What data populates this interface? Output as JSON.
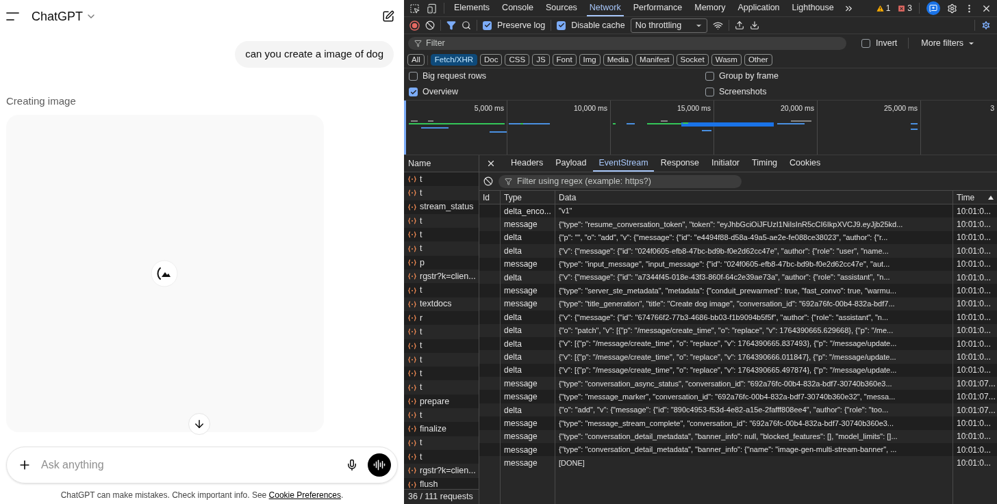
{
  "chat": {
    "title": "ChatGPT",
    "user_message": "can you create a image of dog",
    "status": "Creating image",
    "composer": {
      "placeholder": "Ask anything"
    },
    "disclaimer": "ChatGPT can make mistakes. Check important info. See ",
    "disclaimer_link": "Cookie Preferences",
    "disclaimer_end": "."
  },
  "devtools": {
    "tabs": [
      {
        "label": "Elements",
        "selected": false
      },
      {
        "label": "Console",
        "selected": false
      },
      {
        "label": "Sources",
        "selected": false
      },
      {
        "label": "Network",
        "selected": true
      },
      {
        "label": "Performance",
        "selected": false
      },
      {
        "label": "Memory",
        "selected": false
      },
      {
        "label": "Application",
        "selected": false
      },
      {
        "label": "Lighthouse",
        "selected": false
      }
    ],
    "warnings": "1",
    "errors": "3",
    "preserve_log": {
      "label": "Preserve log",
      "checked": true
    },
    "disable_cache": {
      "label": "Disable cache",
      "checked": true
    },
    "throttling": "No throttling",
    "filter": {
      "placeholder": "Filter"
    },
    "invert": {
      "label": "Invert",
      "checked": false
    },
    "more_filters": "More filters",
    "type_filters": [
      {
        "label": "All",
        "selected": false
      },
      {
        "label": "Fetch/XHR",
        "selected": true
      },
      {
        "label": "Doc",
        "selected": false
      },
      {
        "label": "CSS",
        "selected": false
      },
      {
        "label": "JS",
        "selected": false
      },
      {
        "label": "Font",
        "selected": false
      },
      {
        "label": "Img",
        "selected": false
      },
      {
        "label": "Media",
        "selected": false
      },
      {
        "label": "Manifest",
        "selected": false
      },
      {
        "label": "Socket",
        "selected": false
      },
      {
        "label": "Wasm",
        "selected": false
      },
      {
        "label": "Other",
        "selected": false
      }
    ],
    "options": [
      {
        "label": "Big request rows",
        "checked": false
      },
      {
        "label": "Group by frame",
        "checked": false
      },
      {
        "label": "Overview",
        "checked": true
      },
      {
        "label": "Screenshots",
        "checked": false
      }
    ],
    "overview_ticks": [
      "5,000 ms",
      "10,000 ms",
      "15,000 ms",
      "20,000 ms",
      "25,000 ms",
      "3"
    ],
    "requests": {
      "column": "Name",
      "items": [
        "t",
        "t",
        "stream_status",
        "t",
        "t",
        "t",
        "p",
        "rgstr?k=clien...",
        "t",
        "textdocs",
        "r",
        "t",
        "t",
        "t",
        "t",
        "t",
        "prepare",
        "t",
        "finalize",
        "t",
        "t",
        "rgstr?k=clien...",
        "flush"
      ],
      "summary": "36 / 111 requests"
    },
    "detail_tabs": [
      {
        "label": "Headers",
        "selected": false
      },
      {
        "label": "Payload",
        "selected": false
      },
      {
        "label": "EventStream",
        "selected": true
      },
      {
        "label": "Response",
        "selected": false
      },
      {
        "label": "Initiator",
        "selected": false
      },
      {
        "label": "Timing",
        "selected": false
      },
      {
        "label": "Cookies",
        "selected": false
      }
    ],
    "event_filter": {
      "placeholder": "Filter using regex (example: https?)"
    },
    "events": {
      "columns": [
        "Id",
        "Type",
        "Data",
        "Time"
      ],
      "rows": [
        {
          "type": "delta_enco...",
          "data": "\"v1\"",
          "time": "10:01:0..."
        },
        {
          "type": "message",
          "data": "{\"type\": \"resume_conversation_token\", \"token\": \"eyJhbGciOiJFUzI1NiIsInR5cCI6IkpXVCJ9.eyJjb25kd...",
          "time": "10:01:0..."
        },
        {
          "type": "delta",
          "data": "{\"p\": \"\", \"o\": \"add\", \"v\": {\"message\": {\"id\": \"e4494f88-d58a-49a5-ae2e-fe088ce38023\", \"author\": {\"r...",
          "time": "10:01:0..."
        },
        {
          "type": "delta",
          "data": "{\"v\": {\"message\": {\"id\": \"024f0605-efb8-47bc-bd9b-f0e2d62cc47e\", \"author\": {\"role\": \"user\", \"name...",
          "time": "10:01:0..."
        },
        {
          "type": "message",
          "data": "{\"type\": \"input_message\", \"input_message\": {\"id\": \"024f0605-efb8-47bc-bd9b-f0e2d62cc47e\", \"aut...",
          "time": "10:01:0..."
        },
        {
          "type": "delta",
          "data": "{\"v\": {\"message\": {\"id\": \"a7344f45-018e-43f3-860f-64c2e39ae73a\", \"author\": {\"role\": \"assistant\", \"n...",
          "time": "10:01:0..."
        },
        {
          "type": "message",
          "data": "{\"type\": \"server_ste_metadata\", \"metadata\": {\"conduit_prewarmed\": true, \"fast_convo\": true, \"warmu...",
          "time": "10:01:0..."
        },
        {
          "type": "message",
          "data": "{\"type\": \"title_generation\", \"title\": \"Create dog image\", \"conversation_id\": \"692a76fc-00b4-832a-bdf7...",
          "time": "10:01:0..."
        },
        {
          "type": "delta",
          "data": "{\"v\": {\"message\": {\"id\": \"674766f2-77b3-4686-bb03-f1b9094b5f5f\", \"author\": {\"role\": \"assistant\", \"n...",
          "time": "10:01:0..."
        },
        {
          "type": "delta",
          "data": "{\"o\": \"patch\", \"v\": [{\"p\": \"/message/create_time\", \"o\": \"replace\", \"v\": 1764390665.629668}, {\"p\": \"/me...",
          "time": "10:01:0..."
        },
        {
          "type": "delta",
          "data": "{\"v\": [{\"p\": \"/message/create_time\", \"o\": \"replace\", \"v\": 1764390665.837493}, {\"p\": \"/message/update...",
          "time": "10:01:0..."
        },
        {
          "type": "delta",
          "data": "{\"v\": [{\"p\": \"/message/create_time\", \"o\": \"replace\", \"v\": 1764390666.011847}, {\"p\": \"/message/update...",
          "time": "10:01:0..."
        },
        {
          "type": "delta",
          "data": "{\"v\": [{\"p\": \"/message/create_time\", \"o\": \"replace\", \"v\": 1764390665.497874}, {\"p\": \"/message/update...",
          "time": "10:01:0..."
        },
        {
          "type": "message",
          "data": "{\"type\": \"conversation_async_status\", \"conversation_id\": \"692a76fc-00b4-832a-bdf7-30740b360e3...",
          "time": "10:01:07..."
        },
        {
          "type": "message",
          "data": "{\"type\": \"message_marker\", \"conversation_id\": \"692a76fc-00b4-832a-bdf7-30740b360e32\", \"messa...",
          "time": "10:01:07..."
        },
        {
          "type": "delta",
          "data": "{\"o\": \"add\", \"v\": {\"message\": {\"id\": \"890c4953-f53d-4e82-a15e-2fafff808ee4\", \"author\": {\"role\": \"too...",
          "time": "10:01:07..."
        },
        {
          "type": "message",
          "data": "{\"type\": \"message_stream_complete\", \"conversation_id\": \"692a76fc-00b4-832a-bdf7-30740b360e3...",
          "time": "10:01:0..."
        },
        {
          "type": "message",
          "data": "{\"type\": \"conversation_detail_metadata\", \"banner_info\": null, \"blocked_features\": [], \"model_limits\": []...",
          "time": "10:01:0..."
        },
        {
          "type": "message",
          "data": "{\"type\": \"conversation_detail_metadata\", \"banner_info\": {\"name\": \"image-gen-multi-stream-banner\", ...",
          "time": "10:01:0..."
        },
        {
          "type": "message",
          "data": "[DONE]",
          "time": "10:01:0..."
        }
      ]
    }
  }
}
